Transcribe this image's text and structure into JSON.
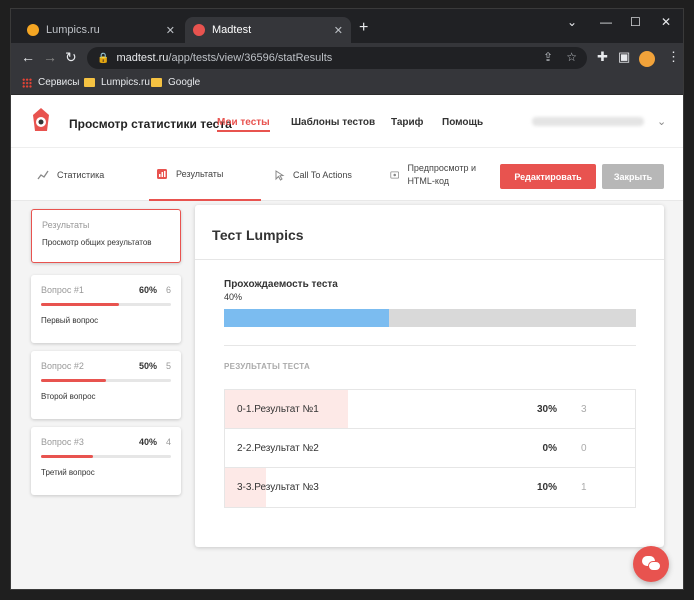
{
  "browser": {
    "tabs": [
      {
        "title": "Lumpics.ru",
        "favicon_color": "#f5a623",
        "active": false
      },
      {
        "title": "Madtest",
        "favicon_color": "#e8534f",
        "active": true
      }
    ],
    "address": {
      "host": "madtest.ru",
      "path": "/app/tests/view/36596/statResults"
    },
    "bookmarks": [
      "Сервисы",
      "Lumpics.ru",
      "Google"
    ]
  },
  "header": {
    "title": "Просмотр статистики теста",
    "nav": [
      "Мои тесты",
      "Шаблоны тестов",
      "Тариф",
      "Помощь"
    ]
  },
  "subnav": {
    "tabs": [
      "Статистика",
      "Результаты",
      "Call To Actions",
      "Предпросмотр и HTML-код"
    ],
    "edit_label": "Редактировать",
    "close_label": "Закрыть"
  },
  "sidebar": {
    "summary": {
      "title": "Результаты",
      "subtitle": "Просмотр общих результатов"
    },
    "questions": [
      {
        "label": "Вопрос #1",
        "percent": "60%",
        "count": "6",
        "name": "Первый вопрос",
        "fill": 0.6
      },
      {
        "label": "Вопрос #2",
        "percent": "50%",
        "count": "5",
        "name": "Второй вопрос",
        "fill": 0.5
      },
      {
        "label": "Вопрос #3",
        "percent": "40%",
        "count": "4",
        "name": "Третий вопрос",
        "fill": 0.4
      }
    ]
  },
  "main": {
    "title": "Тест Lumpics",
    "pass_label": "Прохождаемость теста",
    "pass_value": "40%",
    "pass_fill": 0.4,
    "section_label": "РЕЗУЛЬТАТЫ ТЕСТА",
    "results": [
      {
        "name": "0-1.Результат №1",
        "percent": "30%",
        "count": "3",
        "fill": 0.3
      },
      {
        "name": "2-2.Результат №2",
        "percent": "0%",
        "count": "0",
        "fill": 0
      },
      {
        "name": "3-3.Результат №3",
        "percent": "10%",
        "count": "1",
        "fill": 0.1
      }
    ]
  },
  "colors": {
    "accent": "#e8534f",
    "progress": "#7bbcf0",
    "muted_button": "#b7b7b7"
  }
}
